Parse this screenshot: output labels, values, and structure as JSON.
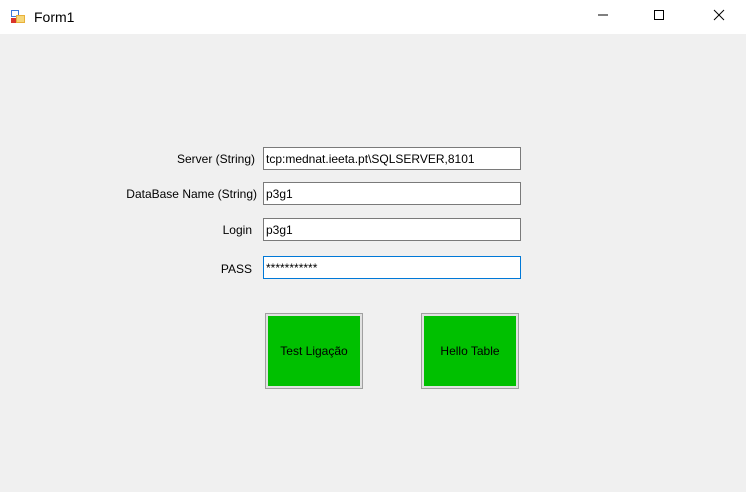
{
  "window": {
    "title": "Form1",
    "app_icon": "winforms-app-icon",
    "controls": {
      "minimize_icon": "minimize-icon",
      "maximize_icon": "maximize-icon",
      "close_icon": "close-icon"
    }
  },
  "form": {
    "server": {
      "label": "Server (String)",
      "value": "tcp:mednat.ieeta.pt\\SQLSERVER,8101"
    },
    "database": {
      "label": "DataBase Name (String)",
      "value": "p3g1"
    },
    "login": {
      "label": "Login",
      "value": "p3g1"
    },
    "pass": {
      "label": "PASS",
      "value": "***********"
    }
  },
  "buttons": {
    "test": "Test Ligação",
    "hello": "Hello Table"
  },
  "colors": {
    "button_face": "#00c000",
    "window_bg": "#f0f0f0",
    "focus_border": "#0078d7"
  }
}
